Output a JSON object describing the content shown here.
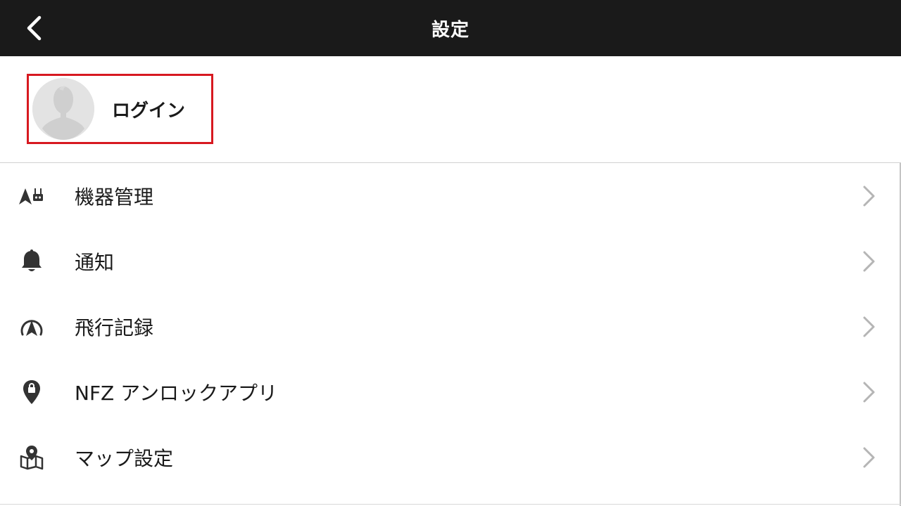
{
  "header": {
    "title": "設定",
    "back_icon": "chevron-left-icon"
  },
  "profile": {
    "login_label": "ログイン",
    "avatar_icon": "user-silhouette-icon",
    "highlight_color": "#d71920"
  },
  "menu": {
    "items": [
      {
        "label": "機器管理",
        "icon": "drone-controller-icon"
      },
      {
        "label": "通知",
        "icon": "bell-icon"
      },
      {
        "label": "飛行記録",
        "icon": "flight-record-icon"
      },
      {
        "label": "NFZ アンロックアプリ",
        "icon": "location-lock-icon"
      },
      {
        "label": "マップ設定",
        "icon": "map-pin-icon"
      }
    ],
    "chevron_icon": "chevron-right-icon"
  },
  "colors": {
    "topbar_bg": "#1a1a1a",
    "text": "#1a1a1a",
    "icon": "#333333",
    "chevron": "#b5b5b5",
    "divider": "#d0d0d0"
  }
}
